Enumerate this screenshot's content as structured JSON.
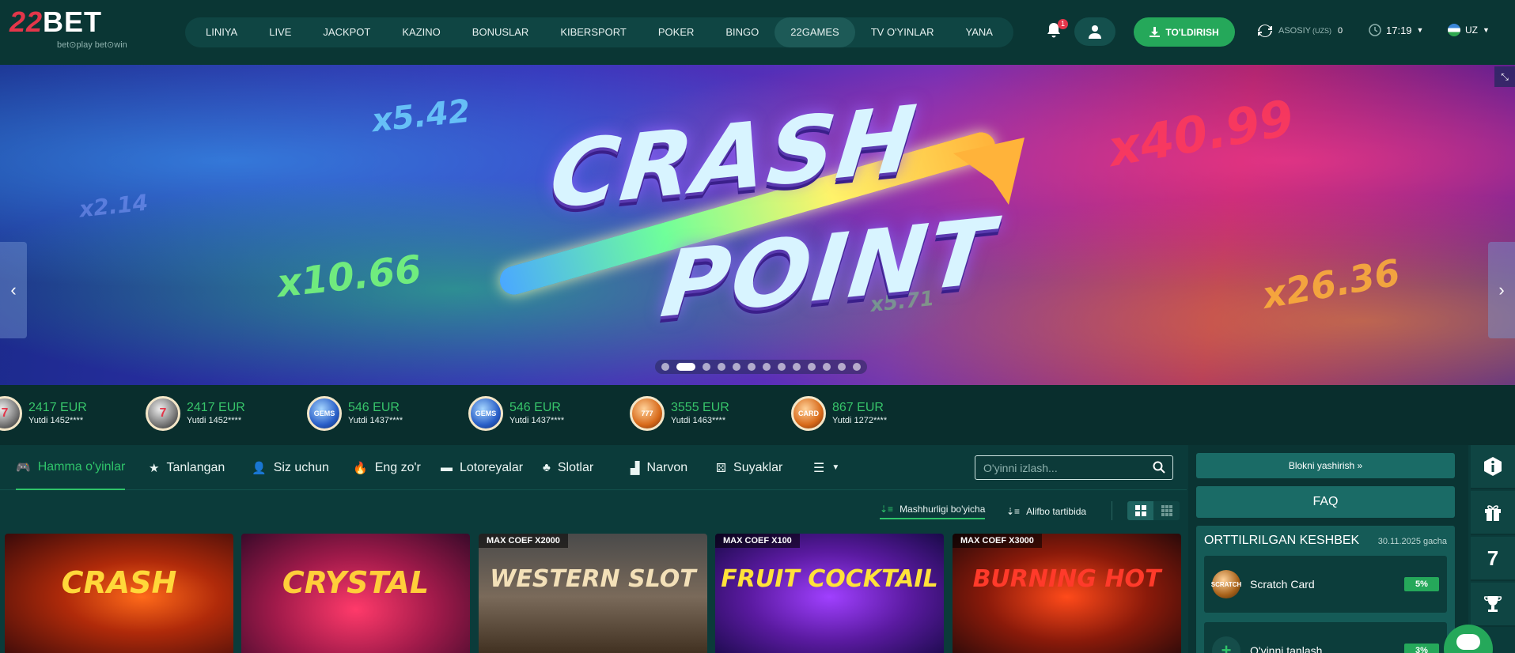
{
  "brand": {
    "logo_num": "22",
    "logo_text": "BET",
    "tagline": "bet⊙play  bet⊙win"
  },
  "nav": {
    "items": [
      "LINIYA",
      "LIVE",
      "JACKPOT",
      "KAZINO",
      "BONUSLAR",
      "KIBERSPORT",
      "POKER",
      "BINGO",
      "22GAMES",
      "TV O'YINLAR",
      "YANA"
    ],
    "active": "22GAMES"
  },
  "header": {
    "notification_count": "1",
    "topup_label": "TO'LDIRISH",
    "balance_label": "ASOSIY",
    "balance_currency": "(UZS)",
    "balance_value": "0",
    "time": "17:19",
    "lang": "UZ"
  },
  "banner": {
    "title_line1": "CRASH",
    "title_line2": "POINT",
    "multipliers": [
      "x5.42",
      "x2.14",
      "x10.66",
      "x40.99",
      "x26.36",
      "x5.71"
    ],
    "dots_total": 13,
    "dots_active": 2
  },
  "winners": [
    {
      "amount": "2417 EUR",
      "user": "Yutdi 1452****",
      "icon": "seven"
    },
    {
      "amount": "2417 EUR",
      "user": "Yutdi 1452****",
      "icon": "seven"
    },
    {
      "amount": "546 EUR",
      "user": "Yutdi 1437****",
      "icon": "gems-odyssey"
    },
    {
      "amount": "546 EUR",
      "user": "Yutdi 1437****",
      "icon": "gems-odyssey"
    },
    {
      "amount": "3555 EUR",
      "user": "Yutdi 1463****",
      "icon": "scratch"
    },
    {
      "amount": "867 EUR",
      "user": "Yutdi 1272****",
      "icon": "scratch-card"
    }
  ],
  "categories": [
    {
      "label": "Hamma o'yinlar",
      "icon": "gamepad-icon"
    },
    {
      "label": "Tanlangan",
      "icon": "star-icon"
    },
    {
      "label": "Siz uchun",
      "icon": "user-star-icon"
    },
    {
      "label": "Eng zo'r",
      "icon": "flame-icon"
    },
    {
      "label": "Lotoreyalar",
      "icon": "ticket-icon"
    },
    {
      "label": "Slotlar",
      "icon": "cherry-icon"
    },
    {
      "label": "Narvon",
      "icon": "ladder-icon"
    },
    {
      "label": "Suyaklar",
      "icon": "dice-icon"
    }
  ],
  "search": {
    "placeholder": "O'yinni izlash..."
  },
  "sort": {
    "popular": "Mashhurligi bo'yicha",
    "alpha": "Alifbo tartibida"
  },
  "games": [
    {
      "title": "CRASH",
      "badge": ""
    },
    {
      "title": "CRYSTAL",
      "badge": ""
    },
    {
      "title": "WESTERN SLOT",
      "badge": "MAX COEF X2000"
    },
    {
      "title": "FRUIT COCKTAIL",
      "badge": "MAX COEF X100"
    },
    {
      "title": "BURNING HOT",
      "badge": "MAX COEF X3000"
    }
  ],
  "sidebar": {
    "hide_block": "Blokni yashirish »",
    "faq": "FAQ",
    "cashback_title": "ORTTILRILGAN KESHBEK",
    "cashback_date": "30.11.2025 gacha",
    "cashback_items": [
      {
        "name": "Scratch Card",
        "pct": "5%"
      },
      {
        "name": "O'yinni tanlash",
        "pct": "3%"
      }
    ]
  },
  "rail": {
    "seven_label": "7"
  },
  "colors": {
    "accent": "#25a85a",
    "bg": "#0b3b3a",
    "brand_red": "#e3364a"
  }
}
